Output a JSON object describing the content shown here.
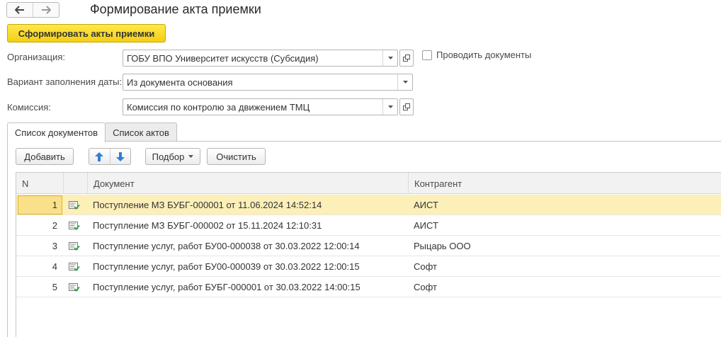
{
  "window": {
    "title": "Формирование акта приемки"
  },
  "nav": {
    "back_icon": "arrow-left-icon",
    "forward_icon": "arrow-right-icon"
  },
  "actions": {
    "form_acts_label": "Сформировать акты приемки"
  },
  "form": {
    "organization": {
      "label": "Организация:",
      "value": "ГОБУ ВПО Университет искусств (Субсидия)"
    },
    "date_fill": {
      "label": "Вариант заполнения даты:",
      "value": "Из документа основания"
    },
    "commission": {
      "label": "Комиссия:",
      "value": "Комиссия по контролю за движением ТМЦ"
    },
    "post_documents": {
      "label": "Проводить документы",
      "checked": false
    }
  },
  "tabs": [
    {
      "label": "Список документов",
      "active": true
    },
    {
      "label": "Список актов",
      "active": false
    }
  ],
  "toolbar": {
    "add_label": "Добавить",
    "pick_label": "Подбор",
    "clear_label": "Очистить"
  },
  "table": {
    "columns": [
      "N",
      "",
      "Документ",
      "Контрагент"
    ],
    "rows": [
      {
        "n": "1",
        "doc": "Поступление МЗ БУБГ-000001 от 11.06.2024 14:52:14",
        "contractor": "АИСТ",
        "selected": true
      },
      {
        "n": "2",
        "doc": "Поступление МЗ БУБГ-000002 от 15.11.2024 12:10:31",
        "contractor": "АИСТ",
        "selected": false
      },
      {
        "n": "3",
        "doc": "Поступление услуг, работ БУ00-000038 от 30.03.2022 12:00:14",
        "contractor": "Рыцарь ООО",
        "selected": false
      },
      {
        "n": "4",
        "doc": "Поступление услуг, работ БУ00-000039 от 30.03.2022 12:00:15",
        "contractor": "Софт",
        "selected": false
      },
      {
        "n": "5",
        "doc": "Поступление услуг, работ БУБГ-000001 от 30.03.2022 14:00:15",
        "contractor": "Софт",
        "selected": false
      }
    ]
  },
  "colors": {
    "accent_button": "#f5d31c",
    "selected_row": "#fcefb8",
    "arrow_blue": "#2f7fd6",
    "doc_icon_green": "#3aa14b"
  }
}
